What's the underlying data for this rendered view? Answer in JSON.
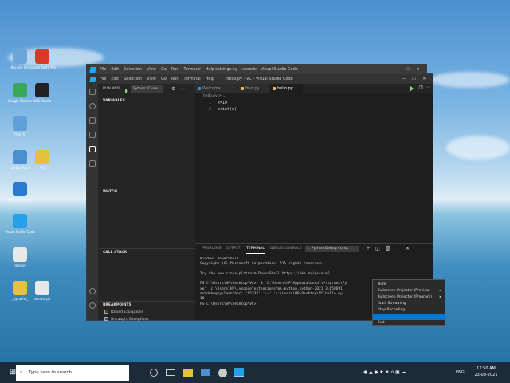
{
  "desktop": {
    "icons": [
      {
        "label": "Recycle Bin",
        "color": "#6aa7d8"
      },
      {
        "label": "Google Earth Pro",
        "color": "#d83a2a"
      },
      {
        "label": "Google Chrome",
        "color": "#3aa75a"
      },
      {
        "label": "OBS Studio",
        "color": "#222222"
      },
      {
        "label": "This PC",
        "color": "#5fa0d8"
      },
      {
        "label": "Control Panel",
        "color": "#4a90d0"
      },
      {
        "label": "VC",
        "color": "#e8c040"
      },
      {
        "label": "Microsoft Edge",
        "color": "#2a7ad0"
      },
      {
        "label": "Visual Studio Code",
        "color": "#23a0e8"
      },
      {
        "label": "hello.py",
        "color": "#e8e8e8"
      },
      {
        "label": "_pycache_",
        "color": "#e8c040"
      },
      {
        "label": "second.py",
        "color": "#e8e8e8"
      }
    ]
  },
  "back_window": {
    "title": "settings.py - .vscode - Visual Studio Code",
    "menu": [
      "File",
      "Edit",
      "Selection",
      "View",
      "Go",
      "Run",
      "Terminal",
      "Help"
    ]
  },
  "window": {
    "title": "hello.py - VC - Visual Studio Code",
    "menu": [
      "File",
      "Edit",
      "Selection",
      "View",
      "Go",
      "Run",
      "Terminal",
      "Help"
    ],
    "controls": [
      "—",
      "☐",
      "✕"
    ]
  },
  "sidebar": {
    "run_label": "RUN AND...",
    "config": "Python: Curre",
    "variables": "VARIABLES",
    "watch": "WATCH",
    "call_stack": "CALL STACK",
    "breakpoints": "BREAKPOINTS",
    "bp_items": [
      {
        "label": "Raised Exceptions",
        "checked": false
      },
      {
        "label": "Uncaught Exceptions",
        "checked": true
      }
    ]
  },
  "tabs": [
    {
      "label": "Welcome",
      "color": "#3c8dd8"
    },
    {
      "label": "first.py",
      "color": "#e8c040"
    },
    {
      "label": "hello.py",
      "color": "#e8c040"
    }
  ],
  "breadcrumb": "hello.py > ...",
  "code": [
    {
      "n": "1",
      "text": "x=10"
    },
    {
      "n": "2",
      "text": "print(x)"
    }
  ],
  "panel": {
    "tabs": [
      "PROBLEMS",
      "OUTPUT",
      "TERMINAL",
      "DEBUG CONSOLE"
    ],
    "terminal_select": "1: Python Debug Consc",
    "lines": [
      "Windows PowerShell",
      "Copyright (C) Microsoft Corporation. All rights reserved.",
      "",
      "Try the new cross-platform PowerShell https://aka.ms/pscore6",
      "",
      "PS C:\\Users\\HP\\Desktop\\VC>  & 'C:\\Users\\HP\\AppData\\Local\\Programs\\Py",
      "xe' 'c:\\Users\\HP\\.vscode\\extensions\\ms-python.python-2021.3.658691",
      "on\\debugpy\\launcher' '65332' '--' 'c:\\Users\\HP\\Desktop\\VC\\hello.py",
      "10",
      "PS C:\\Users\\HP\\Desktop\\VC> "
    ]
  },
  "context_menu": [
    {
      "label": "Hide",
      "sub": false
    },
    {
      "label": "Fullscreen Projector (Preview)",
      "sub": true
    },
    {
      "label": "Fullscreen Projector (Program)",
      "sub": true
    },
    {
      "label": "Start Streaming",
      "sub": false
    },
    {
      "label": "Stop Recording",
      "sub": false
    },
    {
      "label": "",
      "sub": false
    },
    {
      "label": "Exit",
      "sub": false
    }
  ],
  "taskbar": {
    "search_placeholder": "Type here to search",
    "lang": "ENG",
    "time": "11:50 AM",
    "date": "23-03-2021"
  }
}
